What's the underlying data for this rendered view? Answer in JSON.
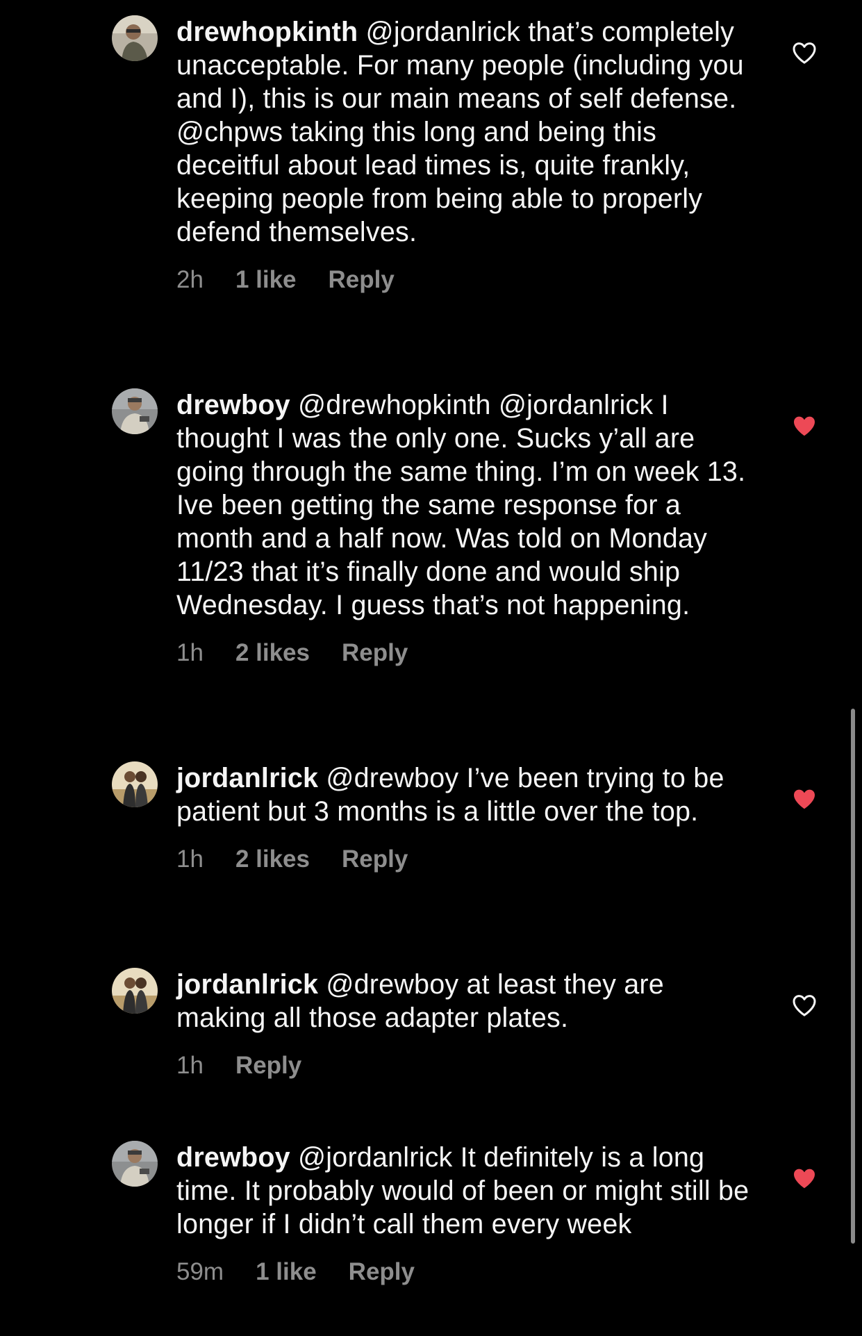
{
  "colors": {
    "background": "#000000",
    "text": "#f5f5f5",
    "meta": "#8e8e8e",
    "liked_heart": "#ed4956",
    "unliked_heart": "#f5f5f5"
  },
  "comments": [
    {
      "username": "drewhopkinth",
      "text": " @jordanlrick that’s completely unacceptable. For many people (including you and I), this is our main means of self defense. @chpws taking this long and being this deceitful about lead times is, quite frankly, keeping people from being able to properly defend themselves.",
      "time": "2h",
      "likes": "1 like",
      "reply": "Reply",
      "liked": false,
      "heart_icon": "heart-outline-icon"
    },
    {
      "username": "drewboy",
      "text": " @drewhopkinth @jordanlrick I thought I was the only one. Sucks y’all are going through the same thing. I’m on week 13. Ive been getting the same response for a month and a half now. Was told on Monday 11/23 that it’s finally done and would ship Wednesday. I guess that’s not happening.",
      "time": "1h",
      "likes": "2 likes",
      "reply": "Reply",
      "liked": true,
      "heart_icon": "heart-filled-icon"
    },
    {
      "username": "jordanlrick",
      "text": " @drewboy I’ve been trying to be patient but 3 months is a little over the top.",
      "time": "1h",
      "likes": "2 likes",
      "reply": "Reply",
      "liked": true,
      "heart_icon": "heart-filled-icon"
    },
    {
      "username": "jordanlrick",
      "text": " @drewboy at least they are making all those adapter plates.",
      "time": "1h",
      "likes": "",
      "reply": "Reply",
      "liked": false,
      "heart_icon": "heart-outline-icon"
    },
    {
      "username": "drewboy",
      "text": " @jordanlrick It definitely is a long time. It probably would of been or might still be longer if I didn’t call them every week",
      "time": "59m",
      "likes": "1 like",
      "reply": "Reply",
      "liked": true,
      "heart_icon": "heart-filled-icon"
    }
  ]
}
